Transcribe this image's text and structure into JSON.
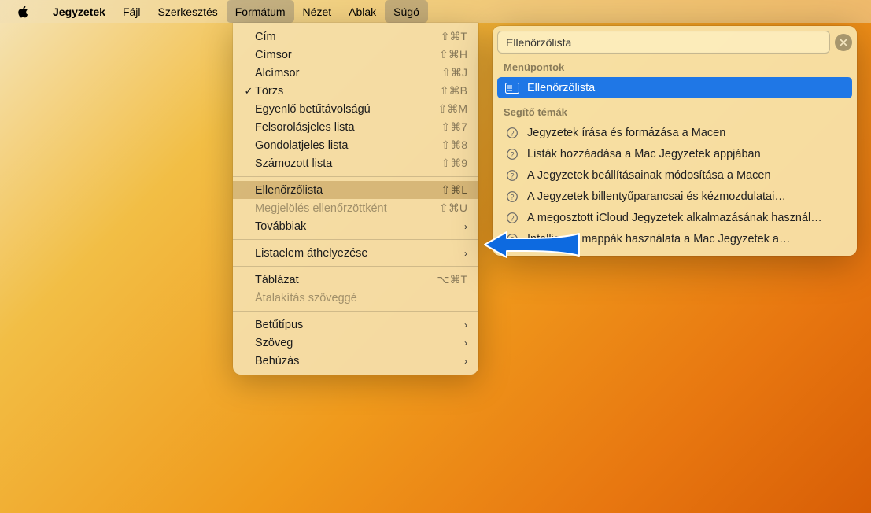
{
  "menubar": {
    "app": "Jegyzetek",
    "items": [
      "Fájl",
      "Szerkesztés",
      "Formátum",
      "Nézet",
      "Ablak",
      "Súgó"
    ],
    "active_index": 2
  },
  "dropdown": {
    "items": [
      {
        "label": "Cím",
        "shortcut": "⇧⌘T"
      },
      {
        "label": "Címsor",
        "shortcut": "⇧⌘H"
      },
      {
        "label": "Alcímsor",
        "shortcut": "⇧⌘J"
      },
      {
        "label": "Törzs",
        "shortcut": "⇧⌘B",
        "checked": true
      },
      {
        "label": "Egyenlő betűtávolságú",
        "shortcut": "⇧⌘M"
      },
      {
        "label": "Felsorolásjeles lista",
        "shortcut": "⇧⌘7"
      },
      {
        "label": "Gondolatjeles lista",
        "shortcut": "⇧⌘8"
      },
      {
        "label": "Számozott lista",
        "shortcut": "⇧⌘9"
      },
      {
        "sep": true
      },
      {
        "label": "Ellenőrzőlista",
        "shortcut": "⇧⌘L",
        "highlight": true
      },
      {
        "label": "Megjelölés ellenőrzöttként",
        "shortcut": "⇧⌘U",
        "disabled": true
      },
      {
        "label": "Továbbiak",
        "submenu": true
      },
      {
        "sep": true
      },
      {
        "label": "Listaelem áthelyezése",
        "submenu": true
      },
      {
        "sep": true
      },
      {
        "label": "Táblázat",
        "shortcut": "⌥⌘T"
      },
      {
        "label": "Átalakítás szöveggé",
        "disabled": true
      },
      {
        "sep": true
      },
      {
        "label": "Betűtípus",
        "submenu": true
      },
      {
        "label": "Szöveg",
        "submenu": true
      },
      {
        "label": "Behúzás",
        "submenu": true
      }
    ]
  },
  "help": {
    "search": "Ellenőrzőlista",
    "menu_items_label": "Menüpontok",
    "menu_items": [
      {
        "label": "Ellenőrzőlista",
        "selected": true
      }
    ],
    "help_topics_label": "Segítő témák",
    "help_topics": [
      "Jegyzetek írása és formázása a Macen",
      "Listák hozzáadása a Mac Jegyzetek appjában",
      "A Jegyzetek beállításainak módosítása a Macen",
      "A Jegyzetek billentyűparancsai és kézmozdulatai…",
      "A megosztott iCloud Jegyzetek alkalmazásának használ…",
      "Intelligens mappák használata a Mac Jegyzetek a…"
    ]
  }
}
